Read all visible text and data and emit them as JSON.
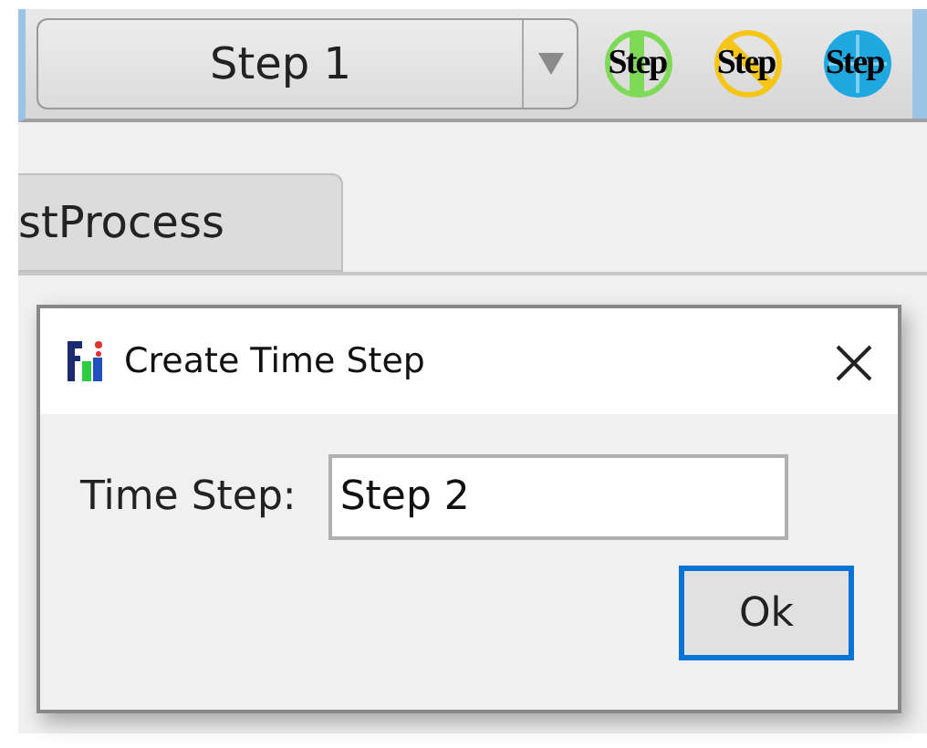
{
  "toolbar": {
    "step_select": {
      "value": "Step 1"
    },
    "step_buttons": [
      {
        "label": "Step",
        "kind": "bar",
        "color": "#7ed957"
      },
      {
        "label": "Step",
        "kind": "slash",
        "color": "#f5c518"
      },
      {
        "label": "Step",
        "kind": "disc",
        "color": "#1fa8e0"
      }
    ]
  },
  "tabs": [
    {
      "label": "stProcess",
      "selected": false
    }
  ],
  "dialog": {
    "title": "Create Time Step",
    "field_label": "Time Step:",
    "field_value": "Step 2",
    "button": "Ok"
  }
}
